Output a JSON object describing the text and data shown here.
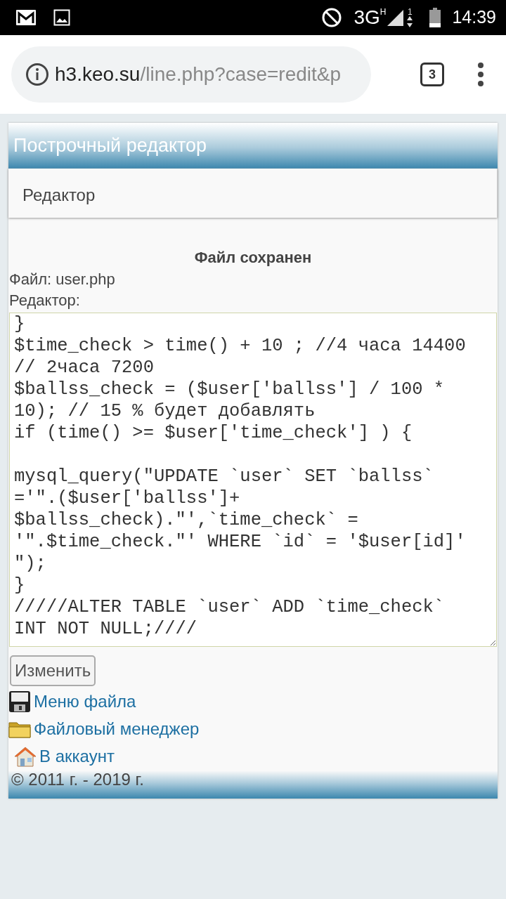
{
  "status_bar": {
    "time": "14:39",
    "network": "3G",
    "network_sup": "H",
    "sim": "1"
  },
  "browser": {
    "url_host": "h3.keo.su",
    "url_path": "/line.php?case=redit&p",
    "tab_count": "3"
  },
  "page": {
    "title": "Построчный редактор",
    "tabs": [
      {
        "label": "Редактор",
        "selected": true
      }
    ],
    "message": "Файл сохранен",
    "file_label": "Файл: user.php",
    "editor_label": "Редактор:",
    "editor_blocks": [
      [
        "}",
        "$time_check > time() + 10 ; //4 часа 14400",
        "// 2часа 7200",
        "$ballss_check = ($user['ballss'] / 100 *",
        "10); // 15 % будет добавлять",
        "if (time() >= $user['time_check'] ) {"
      ],
      [
        "mysql_query(\"UPDATE `user` SET `ballss`",
        "='\".($user['ballss']+",
        "$ballss_check).\"',`time_check` =",
        "'\".$time_check.\"' WHERE `id` = '$user[id]'",
        "\");",
        "}",
        "/////ALTER TABLE `user` ADD `time_check`",
        "INT NOT NULL;////"
      ]
    ],
    "submit": "Изменить",
    "links": [
      {
        "kind": "floppy",
        "label": "Меню файла"
      },
      {
        "kind": "folder",
        "label": "Файловый менеджер"
      },
      {
        "kind": "house",
        "label": "В аккаунт"
      }
    ],
    "footer": "© 2011 г. - 2019 г."
  }
}
